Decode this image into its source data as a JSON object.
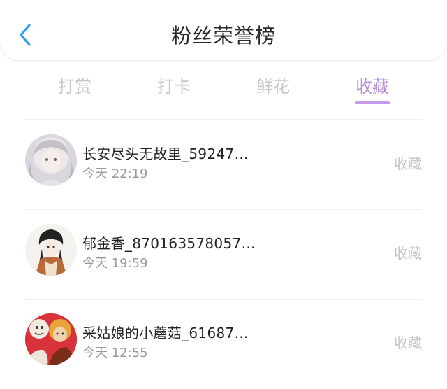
{
  "header": {
    "title": "粉丝荣誉榜",
    "back_icon": "chevron-left-icon",
    "accent_color": "#2f9cf3"
  },
  "tabs": [
    {
      "label": "打赏",
      "active": false
    },
    {
      "label": "打卡",
      "active": false
    },
    {
      "label": "鲜花",
      "active": false
    },
    {
      "label": "收藏",
      "active": true
    }
  ],
  "active_color": "#b58bdc",
  "list": [
    {
      "name": "长安尽头无故里_59247…",
      "time": "今天 22:19",
      "action": "收藏"
    },
    {
      "name": "郁金香_870163578057…",
      "time": "今天 19:59",
      "action": "收藏"
    },
    {
      "name": "采姑娘的小蘑菇_61687…",
      "time": "今天 12:55",
      "action": "收藏"
    }
  ]
}
